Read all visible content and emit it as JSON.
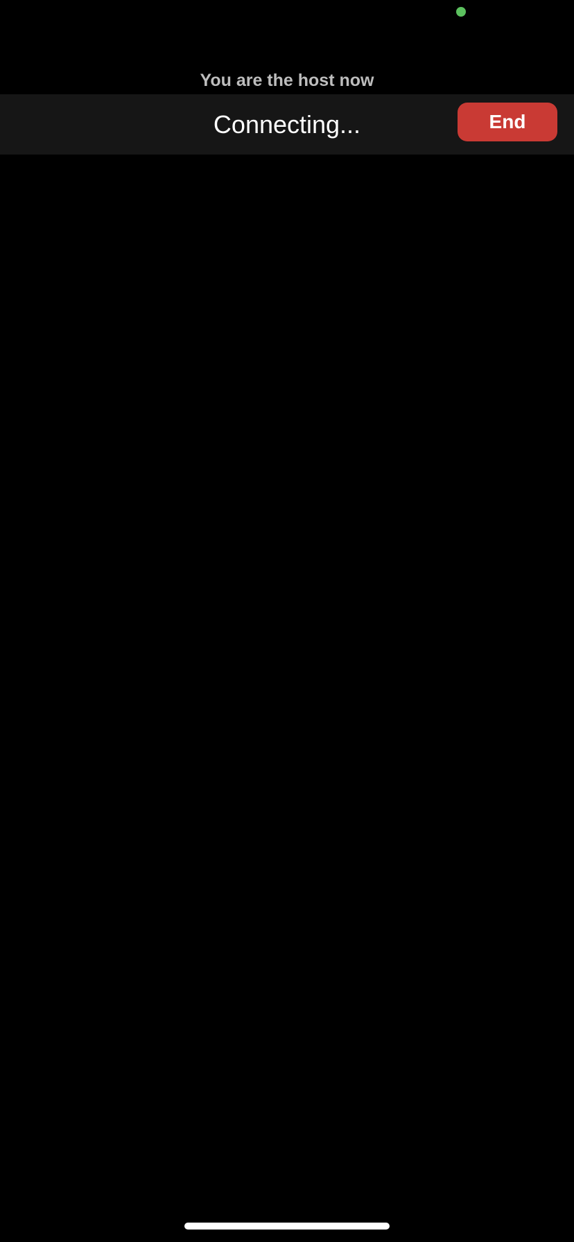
{
  "status_bar": {
    "camera_indicator_color": "#5cc15f"
  },
  "meeting": {
    "host_notice": "You are the host now",
    "status": "Connecting...",
    "end_label": "End",
    "end_color": "#c93a34"
  }
}
